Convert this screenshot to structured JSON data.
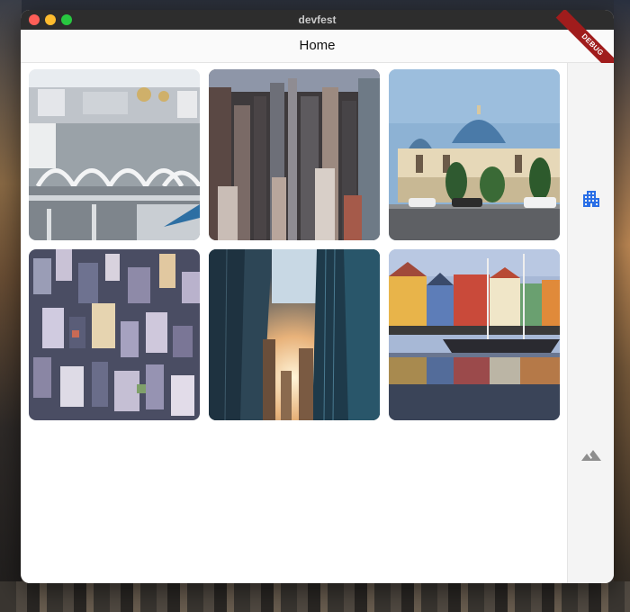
{
  "window": {
    "title": "devfest"
  },
  "appbar": {
    "title": "Home",
    "debug_banner": "DEBUG"
  },
  "colors": {
    "rail_icon_active": "#2a6fe6",
    "rail_icon_inactive": "#8e8e8e",
    "debug_banner": "#a01c1c"
  },
  "rail": {
    "items": [
      {
        "icon": "apartment-icon",
        "selected": true
      },
      {
        "icon": "landscape-icon",
        "selected": false
      }
    ]
  },
  "gallery": {
    "tiles": [
      {
        "subject": "city-with-arches"
      },
      {
        "subject": "skyscrapers-aerial"
      },
      {
        "subject": "domed-mosque"
      },
      {
        "subject": "dense-city-aerial"
      },
      {
        "subject": "glass-towers-sunlight"
      },
      {
        "subject": "harbor-colorful-houses"
      }
    ]
  }
}
